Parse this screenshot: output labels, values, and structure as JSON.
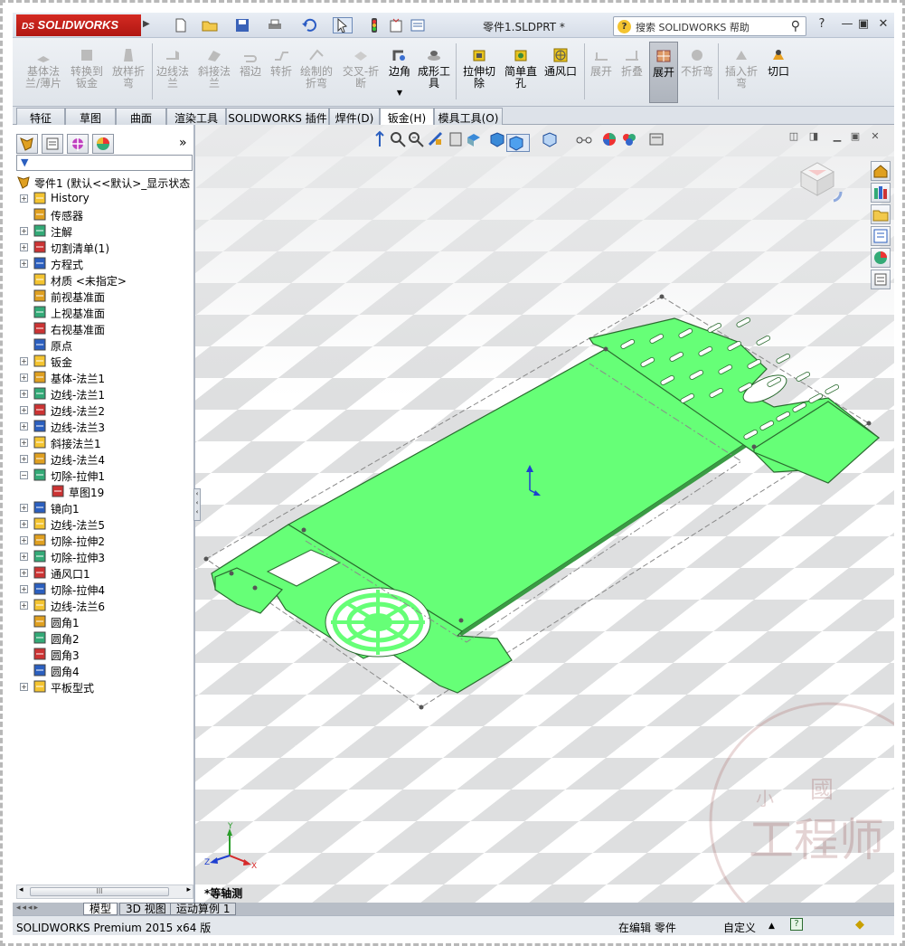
{
  "app": {
    "logo_text": "SOLIDWORKS",
    "doc_title": "零件1.SLDPRT *",
    "search_placeholder": "搜索 SOLIDWORKS 帮助",
    "brand_color": "#c8201a"
  },
  "ribbon": {
    "buttons": [
      {
        "label": "基体法\n兰/薄片",
        "enabled": false
      },
      {
        "label": "转换到\n钣金",
        "enabled": false
      },
      {
        "label": "放样折\n弯",
        "enabled": false
      },
      {
        "label": "边线法\n兰",
        "enabled": false
      },
      {
        "label": "斜接法\n兰",
        "enabled": false
      },
      {
        "label": "褶边",
        "enabled": false
      },
      {
        "label": "转折",
        "enabled": false
      },
      {
        "label": "绘制的\n折弯",
        "enabled": false
      },
      {
        "label": "交叉-折\n断",
        "enabled": false
      },
      {
        "label": "边角",
        "enabled": true
      },
      {
        "label": "成形工\n具",
        "enabled": true
      },
      {
        "label": "拉伸切\n除",
        "enabled": true
      },
      {
        "label": "简单直\n孔",
        "enabled": true
      },
      {
        "label": "通风口",
        "enabled": true
      },
      {
        "label": "展开",
        "enabled": false
      },
      {
        "label": "折叠",
        "enabled": false
      },
      {
        "label": "展开",
        "enabled": true,
        "pressed": true
      },
      {
        "label": "不折弯",
        "enabled": false
      },
      {
        "label": "插入折\n弯",
        "enabled": false
      },
      {
        "label": "切口",
        "enabled": true
      }
    ]
  },
  "tabs": [
    "特征",
    "草图",
    "曲面",
    "渲染工具",
    "SOLIDWORKS 插件",
    "焊件(D)",
    "钣金(H)",
    "模具工具(O)"
  ],
  "active_tab": "钣金(H)",
  "tree": {
    "root": "零件1 (默认<<默认>_显示状态",
    "items": [
      {
        "label": "History",
        "exp": true
      },
      {
        "label": "传感器",
        "exp": false
      },
      {
        "label": "注解",
        "exp": true
      },
      {
        "label": "切割清单(1)",
        "exp": true
      },
      {
        "label": "方程式",
        "exp": true
      },
      {
        "label": "材质 <未指定>",
        "exp": false
      },
      {
        "label": "前视基准面",
        "exp": false
      },
      {
        "label": "上视基准面",
        "exp": false
      },
      {
        "label": "右视基准面",
        "exp": false
      },
      {
        "label": "原点",
        "exp": false
      },
      {
        "label": "钣金",
        "exp": true
      },
      {
        "label": "基体-法兰1",
        "exp": true
      },
      {
        "label": "边线-法兰1",
        "exp": true
      },
      {
        "label": "边线-法兰2",
        "exp": true
      },
      {
        "label": "边线-法兰3",
        "exp": true
      },
      {
        "label": "斜接法兰1",
        "exp": true
      },
      {
        "label": "边线-法兰4",
        "exp": true
      },
      {
        "label": "切除-拉伸1",
        "exp": true,
        "expanded": true
      },
      {
        "label": "草图19",
        "exp": false,
        "child": true
      },
      {
        "label": "镜向1",
        "exp": true
      },
      {
        "label": "边线-法兰5",
        "exp": true
      },
      {
        "label": "切除-拉伸2",
        "exp": true
      },
      {
        "label": "切除-拉伸3",
        "exp": true
      },
      {
        "label": "通风口1",
        "exp": true
      },
      {
        "label": "切除-拉伸4",
        "exp": true
      },
      {
        "label": "边线-法兰6",
        "exp": true
      },
      {
        "label": "圆角1",
        "exp": false
      },
      {
        "label": "圆角2",
        "exp": false
      },
      {
        "label": "圆角3",
        "exp": false
      },
      {
        "label": "圆角4",
        "exp": false
      },
      {
        "label": "平板型式",
        "exp": true
      }
    ]
  },
  "viewport": {
    "view_name": "*等轴测",
    "part_color": "#66ff77"
  },
  "bottom_tabs": [
    "模型",
    "3D 视图",
    "运动算例 1"
  ],
  "status": {
    "product": "SOLIDWORKS Premium 2015 x64 版",
    "mode": "在编辑 零件",
    "units": "自定义"
  }
}
